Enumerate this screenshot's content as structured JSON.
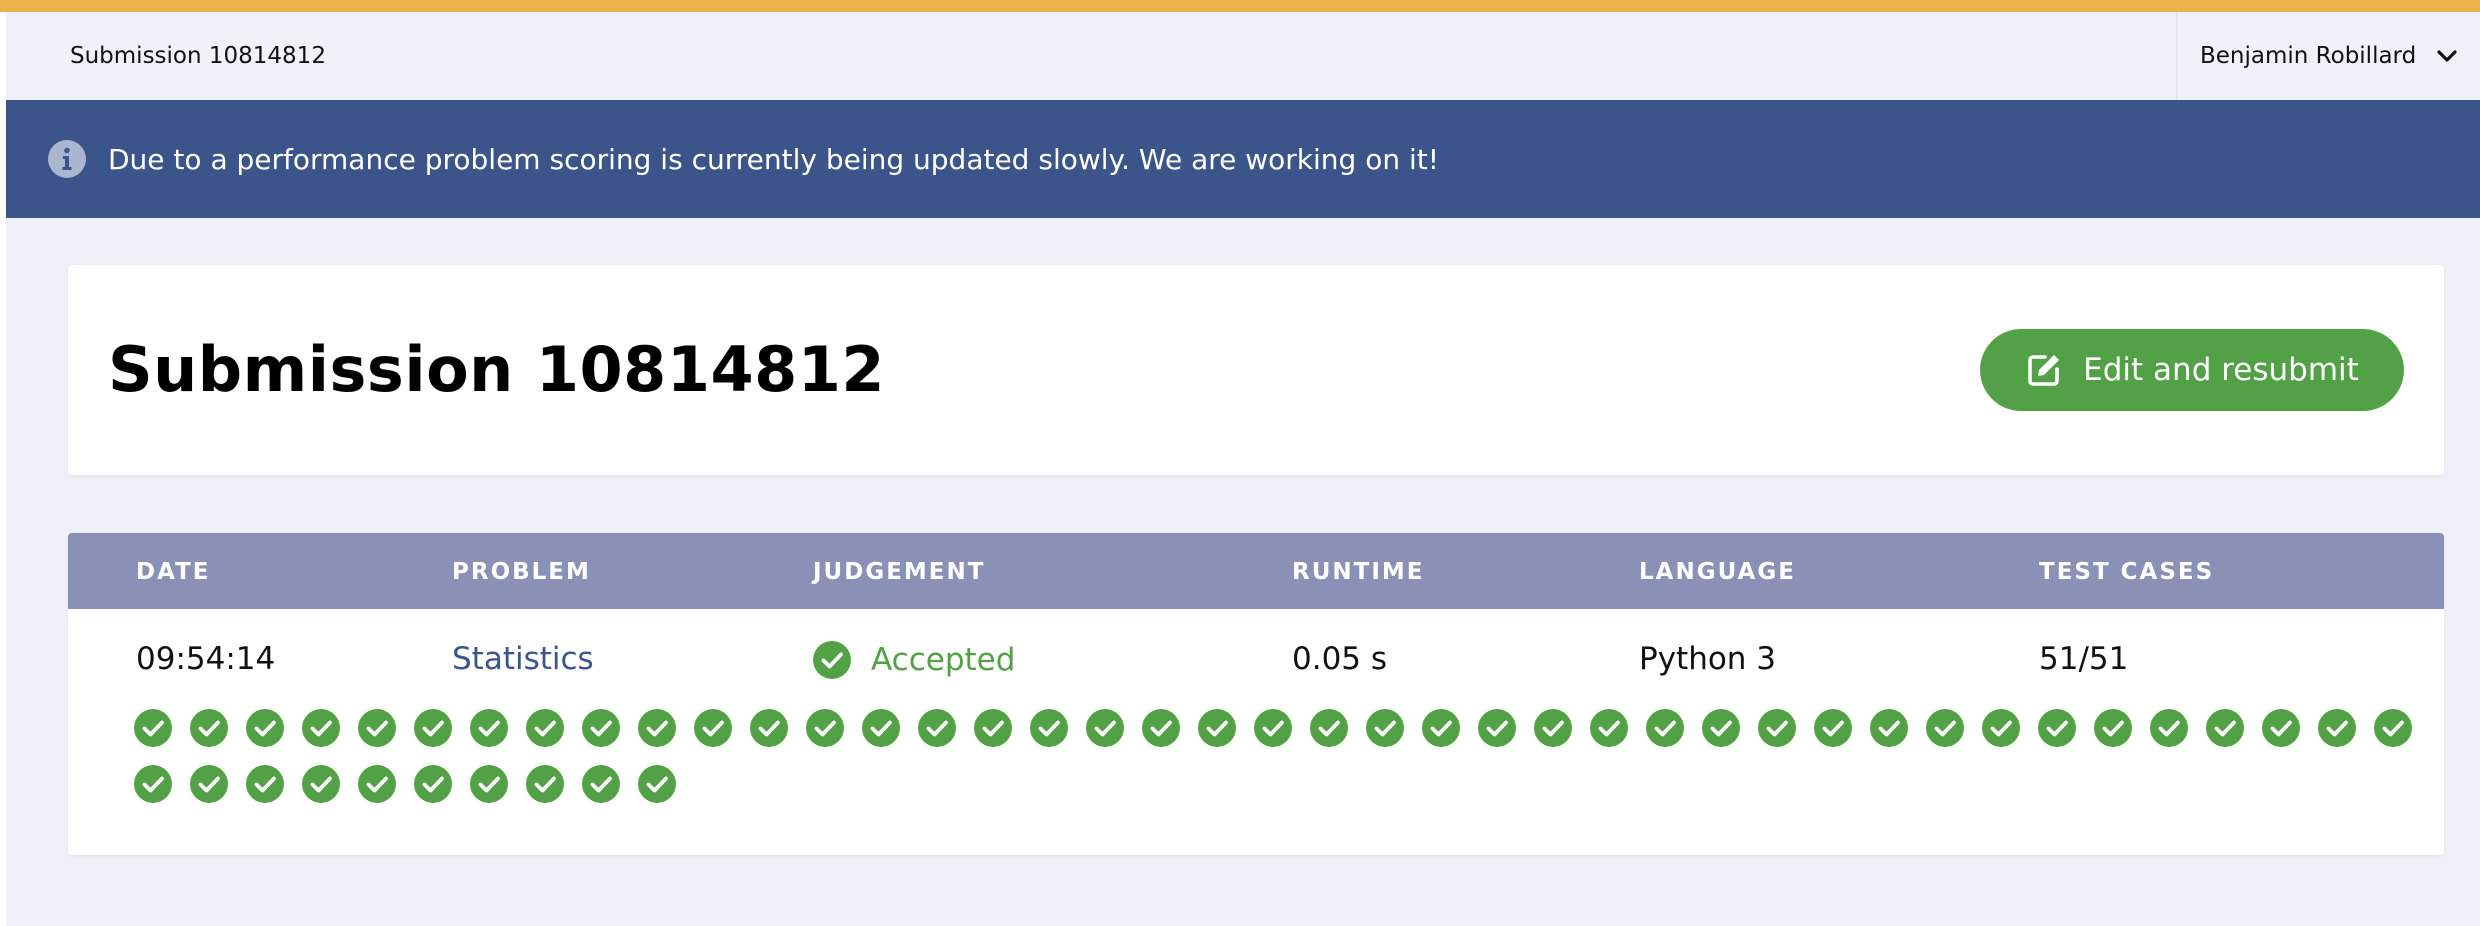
{
  "topbar": {
    "title": "Submission 10814812",
    "user_name": "Benjamin Robillard",
    "user_menu_icon": "chevron-down-icon"
  },
  "banner": {
    "icon": "info-icon",
    "message": "Due to a performance problem scoring is currently being updated slowly. We are working on it!"
  },
  "header": {
    "title": "Submission 10814812",
    "resubmit_label": "Edit and resubmit",
    "resubmit_icon": "edit-icon"
  },
  "table": {
    "headers": {
      "date": "DATE",
      "problem": "PROBLEM",
      "judgement": "JUDGEMENT",
      "runtime": "RUNTIME",
      "language": "LANGUAGE",
      "test_cases": "TEST CASES"
    },
    "row": {
      "date": "09:54:14",
      "problem": "Statistics",
      "judgement": "Accepted",
      "runtime": "0.05 s",
      "language": "Python 3",
      "test_cases": "51/51"
    },
    "test_case_results": {
      "passed": 51,
      "total": 51,
      "icon": "check-circle-icon"
    }
  },
  "colors": {
    "accent_top": "#e9b24a",
    "banner_bg": "#3b558b",
    "success": "#53a146",
    "table_header_bg": "#8b90b6",
    "page_bg": "#eeeff7"
  }
}
